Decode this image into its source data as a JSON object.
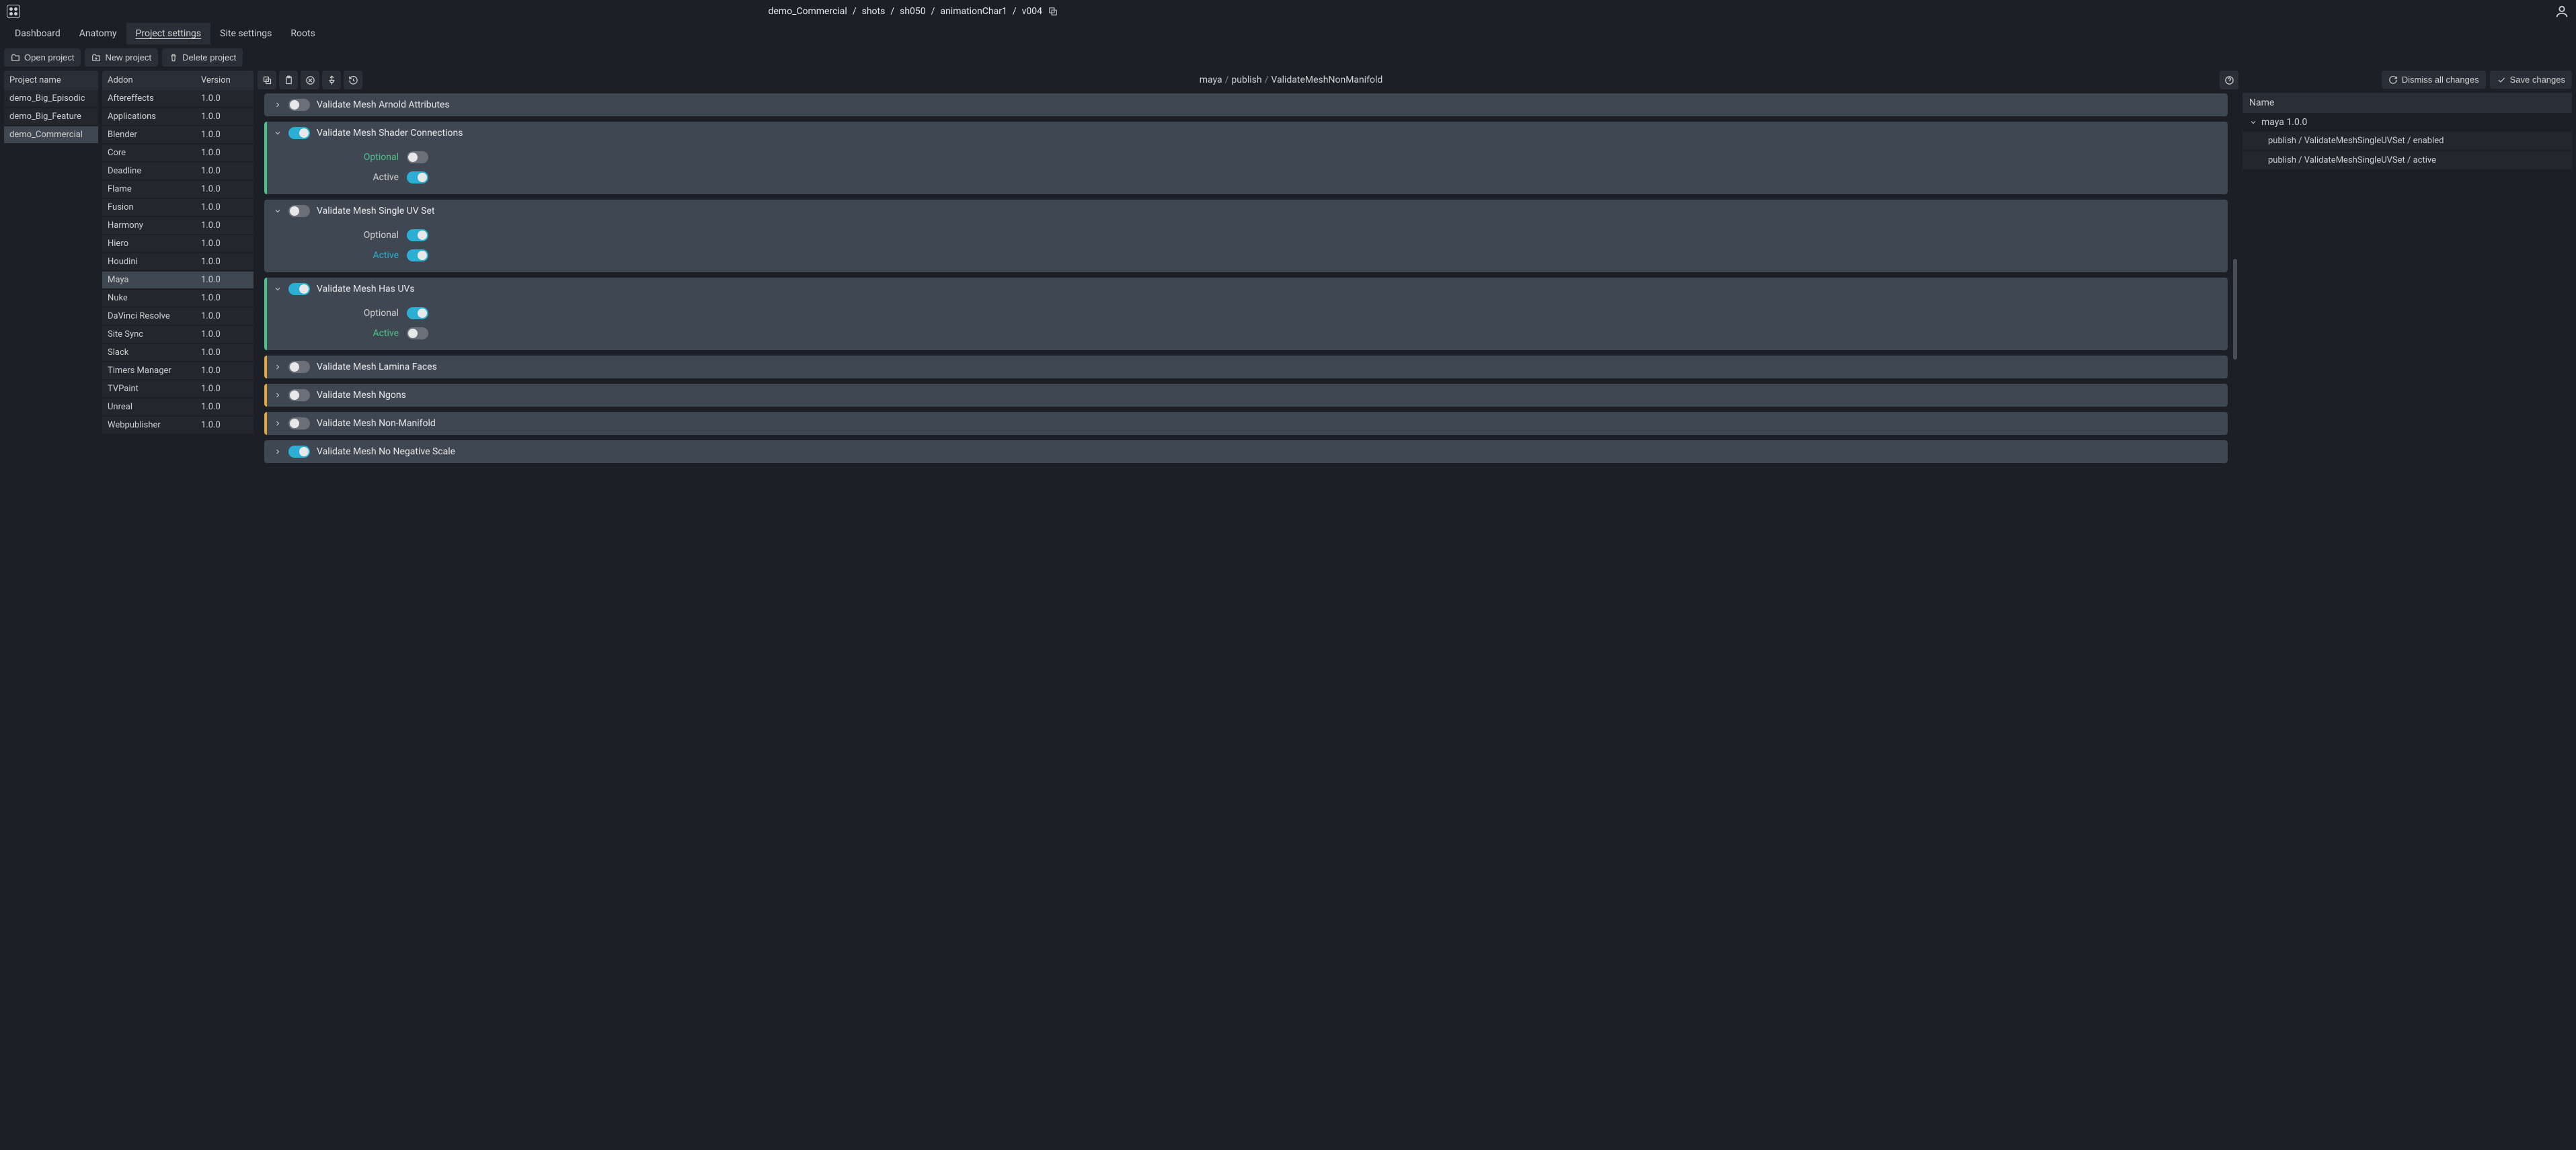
{
  "breadcrumb": [
    "demo_Commercial",
    "shots",
    "sh050",
    "animationChar1",
    "v004"
  ],
  "tabs": {
    "dashboard": "Dashboard",
    "anatomy": "Anatomy",
    "project_settings": "Project settings",
    "site_settings": "Site settings",
    "roots": "Roots"
  },
  "actions": {
    "open": "Open project",
    "new": "New project",
    "delete": "Delete project",
    "dismiss": "Dismiss all changes",
    "save": "Save changes"
  },
  "proj_header": "Project name",
  "projects": [
    {
      "name": "demo_Big_Episodic",
      "selected": false
    },
    {
      "name": "demo_Big_Feature",
      "selected": false
    },
    {
      "name": "demo_Commercial",
      "selected": true
    }
  ],
  "addon_header": {
    "col1": "Addon",
    "col2": "Version"
  },
  "addons": [
    {
      "name": "Aftereffects",
      "ver": "1.0.0"
    },
    {
      "name": "Applications",
      "ver": "1.0.0"
    },
    {
      "name": "Blender",
      "ver": "1.0.0"
    },
    {
      "name": "Core",
      "ver": "1.0.0"
    },
    {
      "name": "Deadline",
      "ver": "1.0.0"
    },
    {
      "name": "Flame",
      "ver": "1.0.0"
    },
    {
      "name": "Fusion",
      "ver": "1.0.0"
    },
    {
      "name": "Harmony",
      "ver": "1.0.0"
    },
    {
      "name": "Hiero",
      "ver": "1.0.0"
    },
    {
      "name": "Houdini",
      "ver": "1.0.0"
    },
    {
      "name": "Maya",
      "ver": "1.0.0",
      "selected": true
    },
    {
      "name": "Nuke",
      "ver": "1.0.0"
    },
    {
      "name": "DaVinci Resolve",
      "ver": "1.0.0"
    },
    {
      "name": "Site Sync",
      "ver": "1.0.0"
    },
    {
      "name": "Slack",
      "ver": "1.0.0"
    },
    {
      "name": "Timers Manager",
      "ver": "1.0.0"
    },
    {
      "name": "TVPaint",
      "ver": "1.0.0"
    },
    {
      "name": "Unreal",
      "ver": "1.0.0"
    },
    {
      "name": "Webpublisher",
      "ver": "1.0.0"
    }
  ],
  "path": [
    "maya",
    "publish",
    "ValidateMeshNonManifold"
  ],
  "labels": {
    "optional": "Optional",
    "active": "Active"
  },
  "validators": [
    {
      "title": "Validate Mesh Arnold Attributes",
      "expanded": false,
      "headToggle": false,
      "mod": ""
    },
    {
      "title": "Validate Mesh Shader Connections",
      "expanded": true,
      "headToggle": true,
      "mod": "green",
      "optional": false,
      "active": true,
      "optMod": "green",
      "actMod": ""
    },
    {
      "title": "Validate Mesh Single UV Set",
      "expanded": true,
      "headToggle": false,
      "mod": "",
      "optional": true,
      "active": true,
      "optMod": "",
      "actMod": "blue"
    },
    {
      "title": "Validate Mesh Has UVs",
      "expanded": true,
      "headToggle": true,
      "mod": "green",
      "optional": true,
      "active": false,
      "optMod": "",
      "actMod": "green"
    },
    {
      "title": "Validate Mesh Lamina Faces",
      "expanded": false,
      "headToggle": false,
      "mod": "orange"
    },
    {
      "title": "Validate Mesh Ngons",
      "expanded": false,
      "headToggle": false,
      "mod": "orange"
    },
    {
      "title": "Validate Mesh Non-Manifold",
      "expanded": false,
      "headToggle": false,
      "mod": "orange"
    },
    {
      "title": "Validate Mesh No Negative Scale",
      "expanded": false,
      "headToggle": true,
      "mod": ""
    }
  ],
  "right_header": "Name",
  "changes_parent": "maya 1.0.0",
  "changes": [
    "publish / ValidateMeshSingleUVSet / enabled",
    "publish / ValidateMeshSingleUVSet / active"
  ]
}
